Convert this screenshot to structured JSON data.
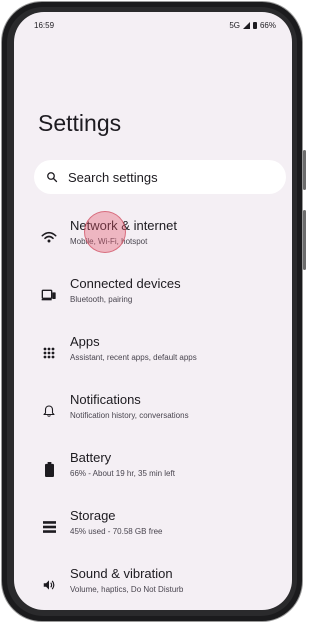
{
  "status_bar": {
    "time": "16:59",
    "network": "5G",
    "battery": "66%"
  },
  "page": {
    "title": "Settings"
  },
  "search": {
    "placeholder": "Search settings"
  },
  "settings_items": [
    {
      "title": "Network & internet",
      "subtitle": "Mobile, Wi-Fi, hotspot",
      "icon": "wifi-icon"
    },
    {
      "title": "Connected devices",
      "subtitle": "Bluetooth, pairing",
      "icon": "connected-devices-icon"
    },
    {
      "title": "Apps",
      "subtitle": "Assistant, recent apps, default apps",
      "icon": "apps-grid-icon"
    },
    {
      "title": "Notifications",
      "subtitle": "Notification history, conversations",
      "icon": "bell-icon"
    },
    {
      "title": "Battery",
      "subtitle": "66% - About 19 hr, 35 min left",
      "icon": "battery-icon"
    },
    {
      "title": "Storage",
      "subtitle": "45% used - 70.58 GB free",
      "icon": "storage-icon"
    },
    {
      "title": "Sound & vibration",
      "subtitle": "Volume, haptics, Do Not Disturb",
      "icon": "speaker-icon"
    }
  ],
  "colors": {
    "background": "#f4eff4",
    "search_bg": "#ffffff",
    "text": "#1d1b20",
    "subtext": "#49454f",
    "touch_indicator": "#e65a6e"
  }
}
